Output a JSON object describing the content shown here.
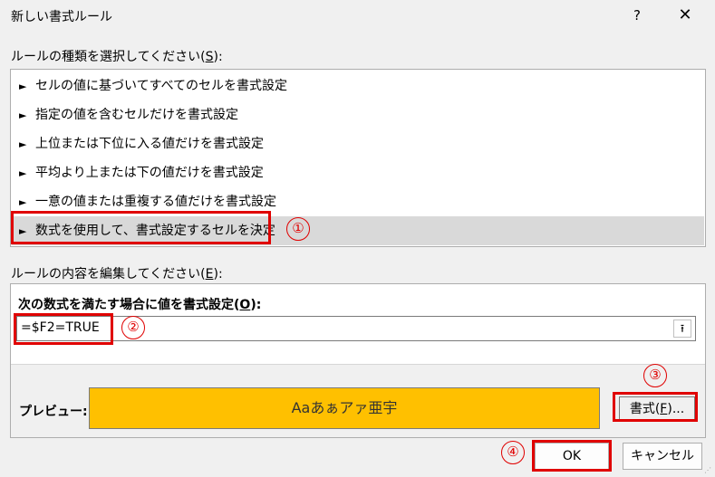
{
  "window": {
    "title": "新しい書式ルール",
    "help_label": "?",
    "close_label": "✕"
  },
  "rule_type": {
    "label": "ルールの種類を選択してください(",
    "accel": "S",
    "label_end": "):",
    "items": [
      {
        "label": "セルの値に基づいてすべてのセルを書式設定"
      },
      {
        "label": "指定の値を含むセルだけを書式設定"
      },
      {
        "label": "上位または下位に入る値だけを書式設定"
      },
      {
        "label": "平均より上または下の値だけを書式設定"
      },
      {
        "label": "一意の値または重複する値だけを書式設定"
      },
      {
        "label": "数式を使用して、書式設定するセルを決定"
      }
    ],
    "arrow": "►",
    "selected_index": 5
  },
  "edit": {
    "label": "ルールの内容を編集してください(",
    "accel": "E",
    "label_end": "):",
    "formula_label_pre": "次の数式を満たす場合に値を書式設定(",
    "formula_accel": "O",
    "formula_label_end": "):",
    "formula_value": "=$F2=TRUE",
    "collapse_icon": "⭱",
    "preview_label": "プレビュー:",
    "preview_text": "Aaあぁアァ亜宇",
    "preview_color": "#ffc000",
    "format_button_pre": "書式(",
    "format_button_accel": "F",
    "format_button_end": ")..."
  },
  "buttons": {
    "ok": "OK",
    "cancel": "キャンセル"
  },
  "annotations": {
    "marker1": "①",
    "marker2": "②",
    "marker3": "③",
    "marker4": "④",
    "highlight_color": "#e00000"
  }
}
